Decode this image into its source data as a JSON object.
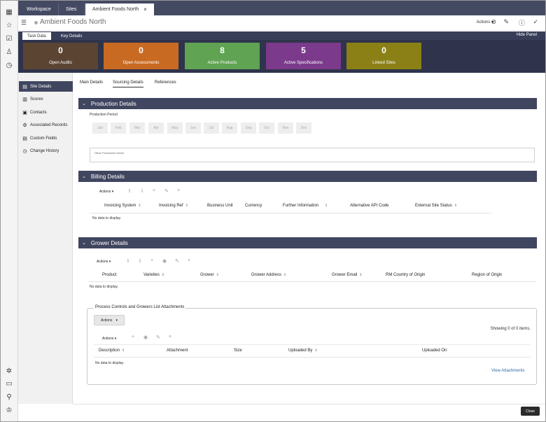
{
  "tabs": {
    "workspace": "Workspace",
    "sites": "Sites",
    "active": "Ambient Foods North",
    "close": "×"
  },
  "header": {
    "menu_icon": "hamburger-icon",
    "title": "Ambient Foods North",
    "actions_label": "Actions ▾"
  },
  "panel": {
    "task_data": "Task Data",
    "key_details": "Key Details",
    "hide_panel": "Hide Panel"
  },
  "kpis": [
    {
      "value": "0",
      "label": "Open Audits",
      "color": "#5c4433"
    },
    {
      "value": "0",
      "label": "Open Assessments",
      "color": "#c96a22"
    },
    {
      "value": "8",
      "label": "Active Products",
      "color": "#5fa353"
    },
    {
      "value": "5",
      "label": "Active Specifications",
      "color": "#7b3a8c"
    },
    {
      "value": "0",
      "label": "Linked Sites",
      "color": "#8a8016"
    }
  ],
  "sidenav": [
    {
      "label": "Site Details",
      "icon": "site-details-icon"
    },
    {
      "label": "Scores",
      "icon": "scores-icon"
    },
    {
      "label": "Contacts",
      "icon": "contacts-icon"
    },
    {
      "label": "Associated Records",
      "icon": "associated-records-icon"
    },
    {
      "label": "Custom Fields",
      "icon": "custom-fields-icon"
    },
    {
      "label": "Change History",
      "icon": "change-history-icon"
    }
  ],
  "subtabs": {
    "main": "Main Details",
    "sourcing": "Sourcing Details",
    "references": "References"
  },
  "production": {
    "title": "Production Details",
    "period_label": "Production Period",
    "months": [
      "Jan",
      "Feb",
      "Mar",
      "Apr",
      "May",
      "Jun",
      "Jul",
      "Aug",
      "Sep",
      "Oct",
      "Nov",
      "Dec"
    ],
    "other_placeholder": "Other Production Detail"
  },
  "billing": {
    "title": "Billing Details",
    "actions": "Actions ▾",
    "columns": [
      "Invoicing System",
      "Invoicing Ref",
      "Business Unit",
      "Currency",
      "Further Information",
      "Alternative API Code",
      "External Site Status"
    ],
    "empty": "No data to display."
  },
  "grower": {
    "title": "Grower Details",
    "actions": "Actions ▾",
    "columns": [
      "Product",
      "Varieties",
      "Grower",
      "Grower Address",
      "Grower Email",
      "RM Country of Origin",
      "Region of Origin"
    ],
    "empty": "No data to display."
  },
  "attachments": {
    "title": "Process Controls and Growers List Attachments",
    "actions_button": "Actions",
    "showing": "Showing 0 of 0 items.",
    "actions": "Actions ▾",
    "columns": [
      "Description",
      "Attachment",
      "Size",
      "Uploaded By",
      "Uploaded On"
    ],
    "empty": "No data to display.",
    "view_link": "View Attachments"
  },
  "footer": {
    "close": "Close"
  }
}
